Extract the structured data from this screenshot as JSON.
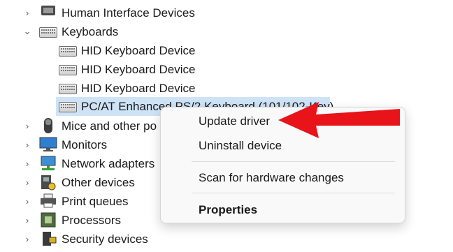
{
  "tree": {
    "items": [
      {
        "label": "Human Interface Devices",
        "icon": "hid-icon",
        "expander": "chevron-right"
      },
      {
        "label": "Keyboards",
        "icon": "keyboard-icon",
        "expander": "chevron-down"
      },
      {
        "label": "HID Keyboard Device",
        "icon": "keyboard-icon"
      },
      {
        "label": "HID Keyboard Device",
        "icon": "keyboard-icon"
      },
      {
        "label": "HID Keyboard Device",
        "icon": "keyboard-icon"
      },
      {
        "label": "PC/AT Enhanced PS/2 Keyboard (101/102-Key)",
        "icon": "keyboard-icon",
        "selected": true
      },
      {
        "label": "Mice and other po",
        "icon": "mouse-icon",
        "expander": "chevron-right"
      },
      {
        "label": "Monitors",
        "icon": "monitor-icon",
        "expander": "chevron-right"
      },
      {
        "label": "Network adapters",
        "icon": "network-icon",
        "expander": "chevron-right"
      },
      {
        "label": "Other devices",
        "icon": "other-device-icon",
        "expander": "chevron-right"
      },
      {
        "label": "Print queues",
        "icon": "printer-icon",
        "expander": "chevron-right"
      },
      {
        "label": "Processors",
        "icon": "processor-icon",
        "expander": "chevron-right"
      },
      {
        "label": "Security devices",
        "icon": "security-icon",
        "expander": "chevron-right"
      }
    ]
  },
  "context_menu": {
    "items": [
      {
        "label": "Update driver"
      },
      {
        "label": "Uninstall device"
      },
      {
        "label": "Scan for hardware changes"
      },
      {
        "label": "Properties",
        "bold": true
      }
    ]
  },
  "annotation": {
    "arrow_color": "#e8141a"
  },
  "colors": {
    "selection": "#cfe3f7",
    "menu_bg": "#f9f9f9"
  }
}
